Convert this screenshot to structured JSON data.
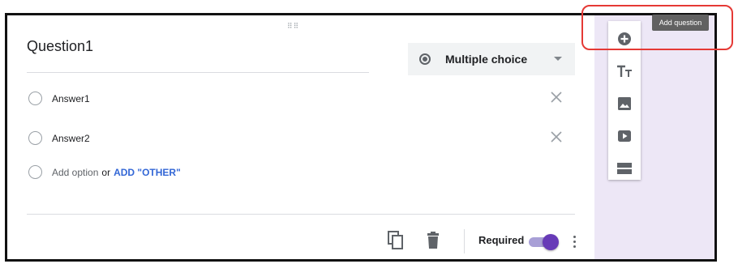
{
  "question": {
    "title": "Question1",
    "type_label": "Multiple choice",
    "options": [
      {
        "label": "Answer1"
      },
      {
        "label": "Answer2"
      }
    ],
    "add_option_label": "Add option",
    "or_label": "or",
    "add_other_label": "ADD \"OTHER\"",
    "drag_handle": "⠿⠿",
    "required_label": "Required",
    "required_on": true
  },
  "toolbar": {
    "tooltip": "Add question",
    "items": [
      "add-question-icon",
      "title-text-icon",
      "image-icon",
      "video-icon",
      "section-icon"
    ]
  },
  "colors": {
    "accent": "#673ab7",
    "link": "#3367d6",
    "side_panel": "#ede7f6",
    "highlight": "#e53935"
  }
}
